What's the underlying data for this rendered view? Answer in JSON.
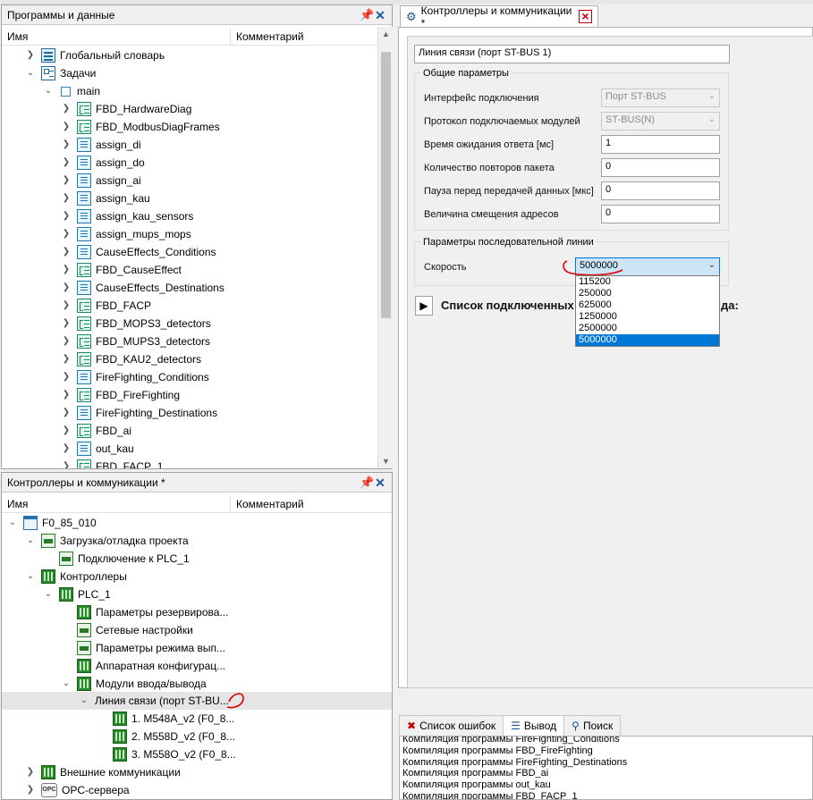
{
  "programs_panel": {
    "title": "Программы и данные",
    "col_name": "Имя",
    "col_comment": "Комментарий",
    "items": [
      {
        "label": "Глобальный словарь"
      },
      {
        "label": "Задачи"
      },
      {
        "label": "main"
      },
      {
        "label": "FBD_HardwareDiag"
      },
      {
        "label": "FBD_ModbusDiagFrames"
      },
      {
        "label": "assign_di"
      },
      {
        "label": "assign_do"
      },
      {
        "label": "assign_ai"
      },
      {
        "label": "assign_kau"
      },
      {
        "label": "assign_kau_sensors"
      },
      {
        "label": "assign_mups_mops"
      },
      {
        "label": "CauseEffects_Conditions"
      },
      {
        "label": "FBD_CauseEffect"
      },
      {
        "label": "CauseEffects_Destinations"
      },
      {
        "label": "FBD_FACP"
      },
      {
        "label": "FBD_MOPS3_detectors"
      },
      {
        "label": "FBD_MUPS3_detectors"
      },
      {
        "label": "FBD_KAU2_detectors"
      },
      {
        "label": "FireFighting_Conditions"
      },
      {
        "label": "FBD_FireFighting"
      },
      {
        "label": "FireFighting_Destinations"
      },
      {
        "label": "FBD_ai"
      },
      {
        "label": "out_kau"
      },
      {
        "label": "FBD_FACP_1"
      }
    ]
  },
  "controllers_panel": {
    "title": "Контроллеры и коммуникации *",
    "col_name": "Имя",
    "col_comment": "Комментарий",
    "items": [
      {
        "label": "F0_85_010"
      },
      {
        "label": "Загрузка/отладка проекта"
      },
      {
        "label": "Подключение к PLC_1"
      },
      {
        "label": "Контроллеры"
      },
      {
        "label": "PLC_1"
      },
      {
        "label": "Параметры резервирова..."
      },
      {
        "label": "Сетевые настройки"
      },
      {
        "label": "Параметры режима вып..."
      },
      {
        "label": "Аппаратная конфигурац..."
      },
      {
        "label": "Модули ввода/вывода"
      },
      {
        "label": "Линия связи (порт ST-BU..."
      },
      {
        "label": "1. M548A_v2 (F0_8..."
      },
      {
        "label": "2. M558D_v2 (F0_8..."
      },
      {
        "label": "3. M558O_v2 (F0_8..."
      },
      {
        "label": "Внешние коммуникации"
      },
      {
        "label": "OPC-сервера"
      }
    ]
  },
  "editor": {
    "tab_title": "Контроллеры и коммуникации *",
    "name_value": "Линия связи (порт ST-BUS 1)",
    "general_group": "Общие параметры",
    "fields": [
      {
        "label": "Интерфейс подключения",
        "value": "Порт ST-BUS"
      },
      {
        "label": "Протокол подключаемых модулей",
        "value": "ST-BUS(N)"
      },
      {
        "label": "Время ожидания ответа [мс]",
        "value": "1"
      },
      {
        "label": "Количество повторов пакета",
        "value": "0"
      },
      {
        "label": "Пауза перед передачей данных [мкс]",
        "value": "0"
      },
      {
        "label": "Величина смещения адресов",
        "value": "0"
      }
    ],
    "serial_group": "Параметры последовательной линии",
    "speed_label": "Скорость",
    "speed_value": "5000000",
    "speed_options": [
      "115200",
      "250000",
      "625000",
      "1250000",
      "2500000",
      "5000000"
    ],
    "modules_header": "Список подключенных модулей ввода-вывода:",
    "modules_header_visible_a": "Список подключенных",
    "modules_header_visible_b": "да:"
  },
  "output": {
    "tab_errors": "Список ошибок",
    "tab_output": "Вывод",
    "tab_search": "Поиск",
    "lines": [
      "Компиляция программы FireFighting_Conditions",
      "Компиляция программы FBD_FireFighting",
      "Компиляция программы FireFighting_Destinations",
      "Компиляция программы FBD_ai",
      "Компиляция программы out_kau",
      "Компиляция программы FBD_FACP_1"
    ]
  },
  "colors": {
    "accent": "#0078d7",
    "annotation": "#e00000",
    "selection": "#e5e5e5"
  }
}
